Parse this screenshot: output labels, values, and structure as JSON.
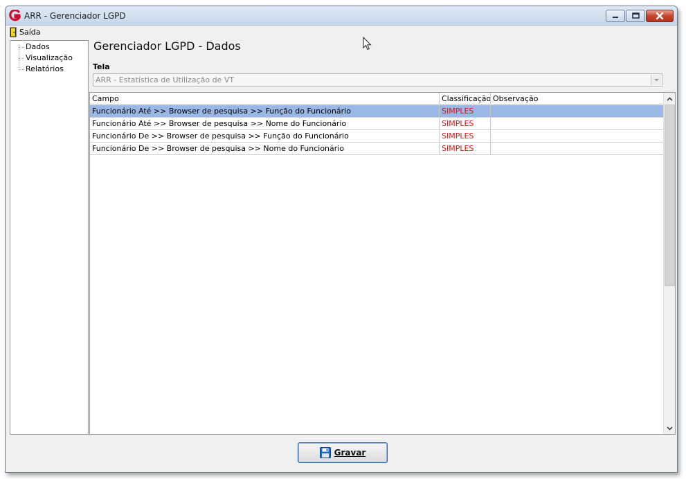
{
  "window": {
    "title": "ARR - Gerenciador LGPD"
  },
  "menu": {
    "items": [
      {
        "label": "Saída",
        "icon": "exit-door-icon"
      }
    ]
  },
  "sidebar": {
    "items": [
      {
        "label": "Dados"
      },
      {
        "label": "Visualização"
      },
      {
        "label": "Relatórios"
      }
    ]
  },
  "main": {
    "title": "Gerenciador LGPD - Dados",
    "tela_label": "Tela",
    "tela_value": "ARR - Estatística de Utilização de VT"
  },
  "grid": {
    "columns": [
      "Campo",
      "Classificação",
      "Observação"
    ],
    "rows": [
      {
        "campo": "Funcionário Até >> Browser de pesquisa >> Função do Funcionário",
        "classificacao": "SIMPLES",
        "observacao": ""
      },
      {
        "campo": "Funcionário Até >> Browser de pesquisa >> Nome do Funcionário",
        "classificacao": "SIMPLES",
        "observacao": ""
      },
      {
        "campo": "Funcionário De >> Browser de pesquisa >> Função do Funcionário",
        "classificacao": "SIMPLES",
        "observacao": ""
      },
      {
        "campo": "Funcionário De >> Browser de pesquisa >> Nome do Funcionário",
        "classificacao": "SIMPLES",
        "observacao": ""
      }
    ],
    "selected_row": 0
  },
  "footer": {
    "save_label": "Gravar"
  },
  "colors": {
    "selection": "#99b8e6",
    "classification_text": "#e01010"
  }
}
